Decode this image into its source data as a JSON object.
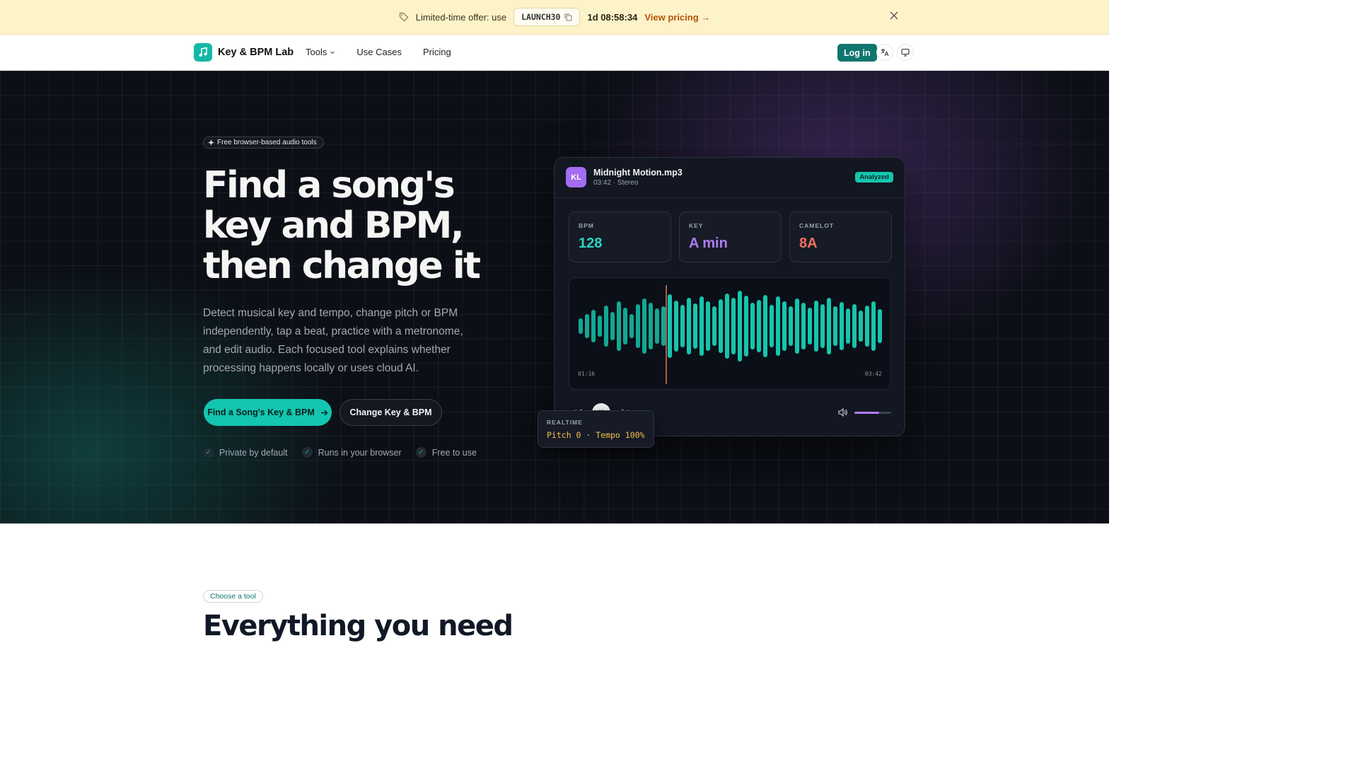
{
  "promo": {
    "text": "Limited-time offer: use",
    "code": "LAUNCH30",
    "timer": "1d 08:58:34",
    "view_label": "View pricing →"
  },
  "nav": {
    "brand": "Key & BPM Lab",
    "links": {
      "tools": "Tools",
      "use_cases": "Use Cases",
      "pricing": "Pricing"
    },
    "login": "Log in"
  },
  "hero": {
    "pill": "Free browser-based audio tools",
    "headline": "Find a song's key and BPM, then change it",
    "subtext": "Detect musical key and tempo, change pitch or BPM independently, tap a beat, practice with a metronome, and edit audio. Each focused tool explains whether processing happens locally or uses cloud AI.",
    "cta_primary": "Find a Song's Key & BPM",
    "cta_secondary": "Change Key & BPM",
    "checks": [
      "Private by default",
      "Runs in your browser",
      "Free to use"
    ]
  },
  "player": {
    "avatar": "KL",
    "file_name": "Midnight Motion.mp3",
    "file_meta": "03:42 · Stereo",
    "badge": "Analyzed",
    "stats": [
      {
        "label": "BPM",
        "value": "128",
        "color": "#2dd4bf"
      },
      {
        "label": "KEY",
        "value": "A min",
        "color": "#b07cf5"
      },
      {
        "label": "CAMELOT",
        "value": "8A",
        "color": "#f2705e"
      }
    ],
    "time_current": "01:16",
    "time_total": "03:42",
    "volume_fraction": 0.68,
    "realtime_label": "REALTIME",
    "realtime_value": "Pitch 0 · Tempo 100%"
  },
  "section": {
    "pill": "Choose a tool",
    "title": "Everything you need"
  },
  "colors": {
    "accent": "#14c6b0",
    "brand_dark": "#0f766e",
    "promo_bg": "#fdf3c8",
    "hero_bg": "#0c0f16"
  }
}
